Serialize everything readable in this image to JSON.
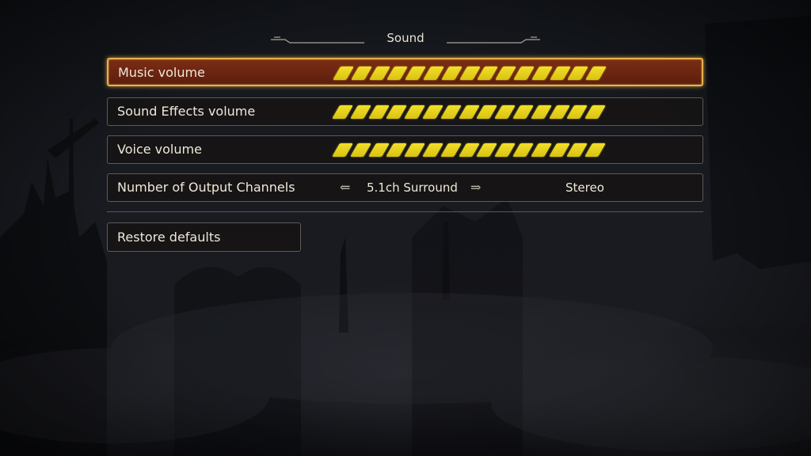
{
  "header": {
    "title": "Sound"
  },
  "settings": [
    {
      "label": "Music volume",
      "level": 15,
      "max": 15,
      "selected": true
    },
    {
      "label": "Sound Effects volume",
      "level": 15,
      "max": 15,
      "selected": false
    },
    {
      "label": "Voice volume",
      "level": 15,
      "max": 15,
      "selected": false
    }
  ],
  "output_channels": {
    "label": "Number of Output Channels",
    "prev_icon": "arrow-left-icon",
    "value": "5.1ch Surround",
    "next_icon": "arrow-right-icon",
    "alt_value": "Stereo"
  },
  "restore": {
    "label": "Restore defaults"
  },
  "colors": {
    "accent": "#e6b24a",
    "selected_bg": "#6a2410",
    "bar_fill": "#f2e02a"
  }
}
